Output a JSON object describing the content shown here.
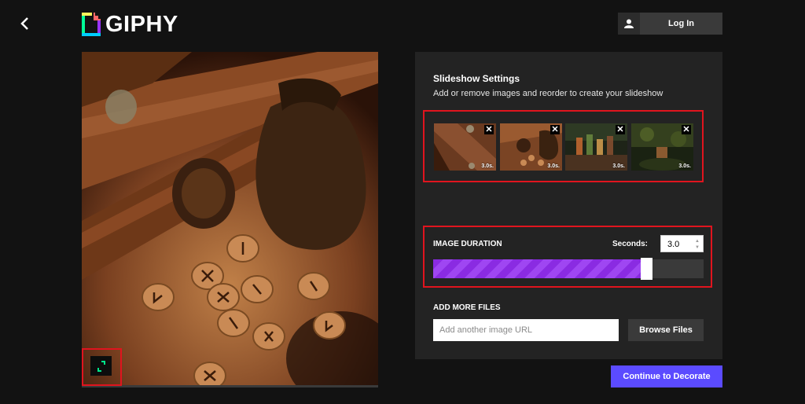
{
  "header": {
    "logo_text": "GIPHY",
    "login_label": "Log In"
  },
  "panel": {
    "title": "Slideshow Settings",
    "subtitle": "Add or remove images and reorder to create your slideshow"
  },
  "thumbnails": [
    {
      "duration": "3.0s.",
      "remove": "✕"
    },
    {
      "duration": "3.0s.",
      "remove": "✕"
    },
    {
      "duration": "3.0s.",
      "remove": "✕"
    },
    {
      "duration": "3.0s.",
      "remove": "✕"
    }
  ],
  "duration": {
    "label": "IMAGE DURATION",
    "seconds_label": "Seconds:",
    "seconds_value": "3.0",
    "slider_fraction": 0.79
  },
  "add_files": {
    "label": "ADD MORE FILES",
    "url_placeholder": "Add another image URL",
    "browse_label": "Browse Files"
  },
  "continue_label": "Continue to Decorate",
  "colors": {
    "accent": "#5b4bff",
    "slider": "#8a2be2",
    "highlight": "#e0141e"
  }
}
